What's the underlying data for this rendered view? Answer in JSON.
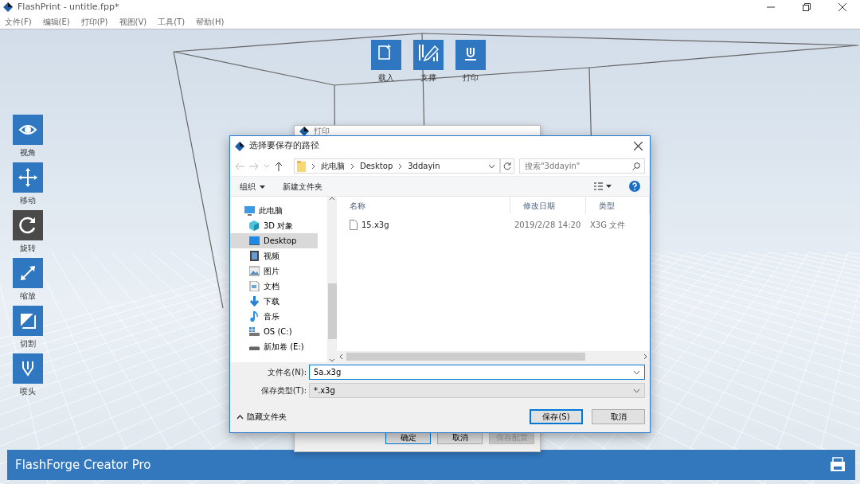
{
  "window": {
    "title": "FlashPrint - untitle.fpp*"
  },
  "menu": [
    "文件(F)",
    "编辑(E)",
    "打印(P)",
    "视图(V)",
    "工具(T)",
    "帮助(H)"
  ],
  "top_toolbar": [
    {
      "kind": "load",
      "label": "载入"
    },
    {
      "kind": "support",
      "label": "支撑"
    },
    {
      "kind": "print",
      "label": "打印"
    }
  ],
  "left_toolbar": [
    {
      "kind": "view",
      "label": "视角",
      "selected": false
    },
    {
      "kind": "move",
      "label": "移动",
      "selected": false
    },
    {
      "kind": "rotate",
      "label": "旋转",
      "selected": true
    },
    {
      "kind": "scale",
      "label": "缩放",
      "selected": false
    },
    {
      "kind": "cut",
      "label": "切割",
      "selected": false
    },
    {
      "kind": "nozzle",
      "label": "喷头",
      "selected": false
    }
  ],
  "print_dialog": {
    "title": "打印",
    "buttons": [
      {
        "label": "确定",
        "default": true,
        "disabled": false
      },
      {
        "label": "取消",
        "default": false,
        "disabled": false
      },
      {
        "label": "保存配置",
        "default": false,
        "disabled": true
      }
    ]
  },
  "save_dialog": {
    "title": "选择要保存的路径",
    "path": [
      "此电脑",
      "Desktop",
      "3ddayin"
    ],
    "search": {
      "placeholder": "搜索\"3ddayin\""
    },
    "toolbar": [
      "组织",
      "新建文件夹"
    ],
    "nav_items": [
      {
        "kind": "pc",
        "label": "此电脑",
        "selected": false
      },
      {
        "kind": "objects3d",
        "label": "3D 对象",
        "selected": false
      },
      {
        "kind": "desktop",
        "label": "Desktop",
        "selected": true
      },
      {
        "kind": "video",
        "label": "视频",
        "selected": false
      },
      {
        "kind": "picture",
        "label": "图片",
        "selected": false
      },
      {
        "kind": "docs",
        "label": "文档",
        "selected": false
      },
      {
        "kind": "download",
        "label": "下载",
        "selected": false
      },
      {
        "kind": "music",
        "label": "音乐",
        "selected": false
      },
      {
        "kind": "osdrive",
        "label": "OS (C:)",
        "selected": false
      },
      {
        "kind": "drive",
        "label": "新加卷 (E:)",
        "selected": false
      }
    ],
    "columns": [
      "名称",
      "修改日期",
      "类型"
    ],
    "files": [
      {
        "name": "15.x3g",
        "date": "2019/2/28 14:20",
        "type": "X3G 文件"
      }
    ],
    "filename": {
      "label": "文件名(N):",
      "value": "5a.x3g"
    },
    "filetype": {
      "label": "保存类型(T):",
      "value": "*.x3g"
    },
    "hide_folders": "隐藏文件夹",
    "buttons": [
      {
        "label": "保存(S)",
        "default": true
      },
      {
        "label": "取消",
        "default": false
      }
    ]
  },
  "status_bar": {
    "printer": "FlashForge Creator Pro"
  }
}
